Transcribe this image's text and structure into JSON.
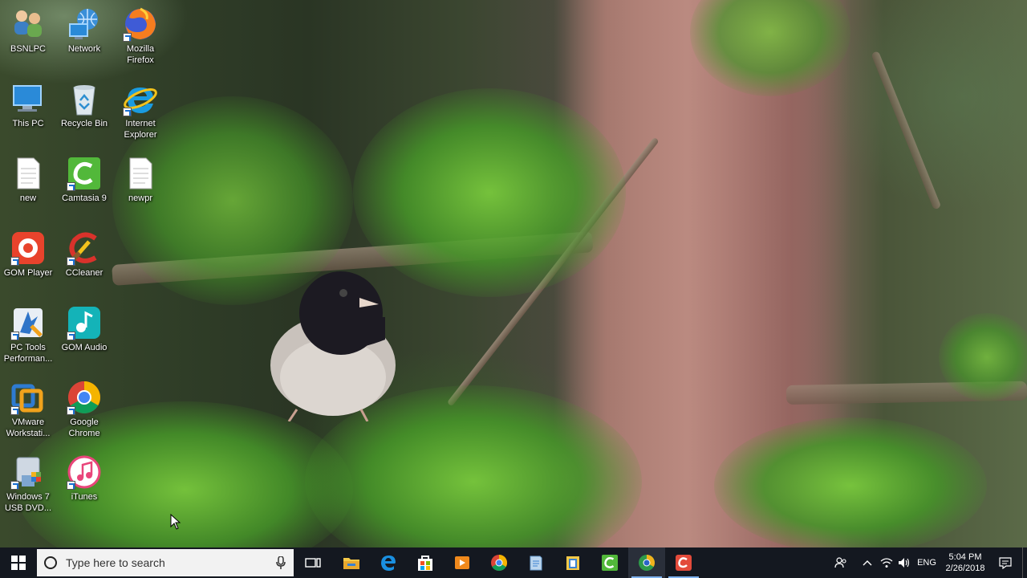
{
  "desktop": {
    "icons": [
      {
        "label": "BSNLPC",
        "icon": "user-group-icon"
      },
      {
        "label": "Network",
        "icon": "network-icon"
      },
      {
        "label": "Mozilla Firefox",
        "icon": "firefox-icon"
      },
      {
        "label": "This PC",
        "icon": "computer-icon"
      },
      {
        "label": "Recycle Bin",
        "icon": "recycle-bin-icon"
      },
      {
        "label": "Internet Explorer",
        "icon": "internet-explorer-icon"
      },
      {
        "label": "new",
        "icon": "document-icon"
      },
      {
        "label": "Camtasia 9",
        "icon": "camtasia-icon"
      },
      {
        "label": "newpr",
        "icon": "document-icon"
      },
      {
        "label": "GOM Player",
        "icon": "gom-player-icon"
      },
      {
        "label": "CCleaner",
        "icon": "ccleaner-icon"
      },
      {
        "label": "PC Tools Performan...",
        "icon": "pc-tools-icon"
      },
      {
        "label": "GOM Audio",
        "icon": "gom-audio-icon"
      },
      {
        "label": "VMware Workstati...",
        "icon": "vmware-icon"
      },
      {
        "label": "Google Chrome",
        "icon": "chrome-icon"
      },
      {
        "label": "Windows 7 USB DVD...",
        "icon": "usb-dvd-tool-icon"
      },
      {
        "label": "iTunes",
        "icon": "itunes-icon"
      }
    ]
  },
  "taskbar": {
    "search_placeholder": "Type here to search",
    "pinned": [
      "task-view-icon",
      "file-explorer-icon",
      "edge-icon",
      "store-icon",
      "media-player-icon",
      "chrome-icon",
      "notepad-icon",
      "explorer-folder-icon",
      "camtasia-icon",
      "chrome-canary-icon",
      "camtasia-recorder-icon"
    ],
    "tray": {
      "language": "ENG",
      "time": "5:04 PM",
      "date": "2/26/2018"
    }
  },
  "colors": {
    "taskbar_bg": "#141820",
    "active_underline": "#7fb2ee",
    "search_bg": "#f2f2f2"
  }
}
